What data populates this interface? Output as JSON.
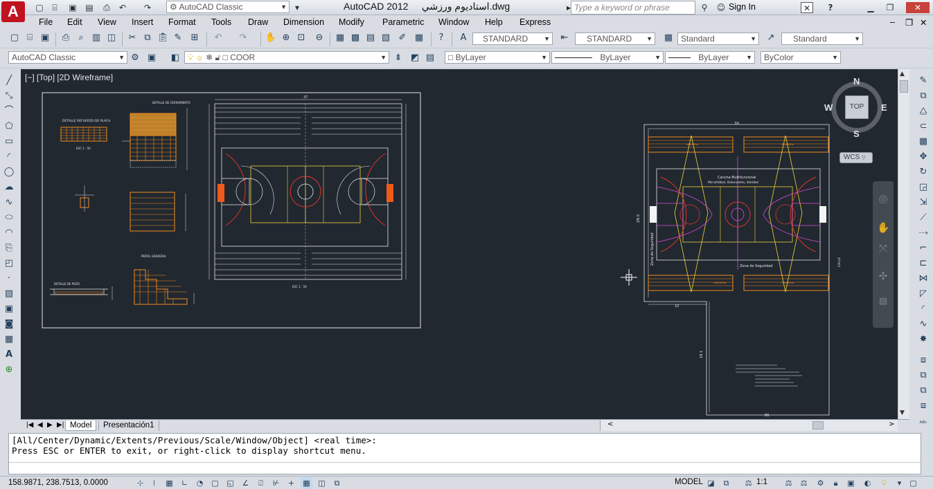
{
  "titlebar": {
    "workspace": "AutoCAD Classic",
    "app_title": "AutoCAD 2012",
    "file_name": "استاديوم ورزشي.dwg",
    "search_placeholder": "Type a keyword or phrase",
    "sign_in": "Sign In",
    "app_logo": "A"
  },
  "menu": [
    "File",
    "Edit",
    "View",
    "Insert",
    "Format",
    "Tools",
    "Draw",
    "Dimension",
    "Modify",
    "Parametric",
    "Window",
    "Help",
    "Express"
  ],
  "styles_toolbar": {
    "text_style": "STANDARD",
    "dim_style": "STANDARD",
    "table_style": "Standard",
    "mleader_style": "Standard"
  },
  "layers_toolbar": {
    "workspace": "AutoCAD Classic",
    "layer": "COOR",
    "color": "ByLayer",
    "linetype": "ByLayer",
    "lineweight": "ByLayer",
    "plotstyle": "ByColor"
  },
  "viewport": {
    "label": "[−] [Top] [2D Wireframe]"
  },
  "viewcube": {
    "north": "N",
    "south": "S",
    "east": "E",
    "west": "W",
    "face": "TOP",
    "ucs": "WCS"
  },
  "tabs": {
    "model": "Model",
    "layout1": "Presentación1"
  },
  "command": {
    "line1": "[All/Center/Dynamic/Extents/Previous/Scale/Window/Object] <real time>:",
    "line2": "Press ESC or ENTER to exit, or right-click to display shortcut menu."
  },
  "status": {
    "coordinates": "158.9871, 238.7513, 0.0000",
    "model": "MODEL",
    "scale": "1:1"
  },
  "drawing_labels": {
    "court_title": "Cancha Multifuncional",
    "court_subtitle": "Microfútbol, Baloncesto, Voleibol",
    "zone_bottom": "Zona de Seguridad",
    "zone_left": "Zona de Seguridad",
    "dim_top": "30",
    "dim_side": "28.5",
    "dim_mid": "10",
    "dim_vert": "18.1",
    "dim_bottom": "80",
    "calle": "CALLE",
    "grada": "GRADERIA",
    "detail_1": "DETALLE REFUERZO DE PLACA",
    "detail_2": "DETALLE DE CERRAMIENTO",
    "detail_3": "PERFIL GRADERIA",
    "detail_4": "DETALLE DE POZO",
    "escala": "ESC 1 : 50",
    "dim_plan": "37"
  },
  "colors": {
    "canvas": "#212830",
    "court_line": "#f2d43c",
    "arc": "#e0322a",
    "orange": "#f28b1e",
    "magenta": "#e04ad8",
    "white_line": "#e8e8e8"
  }
}
